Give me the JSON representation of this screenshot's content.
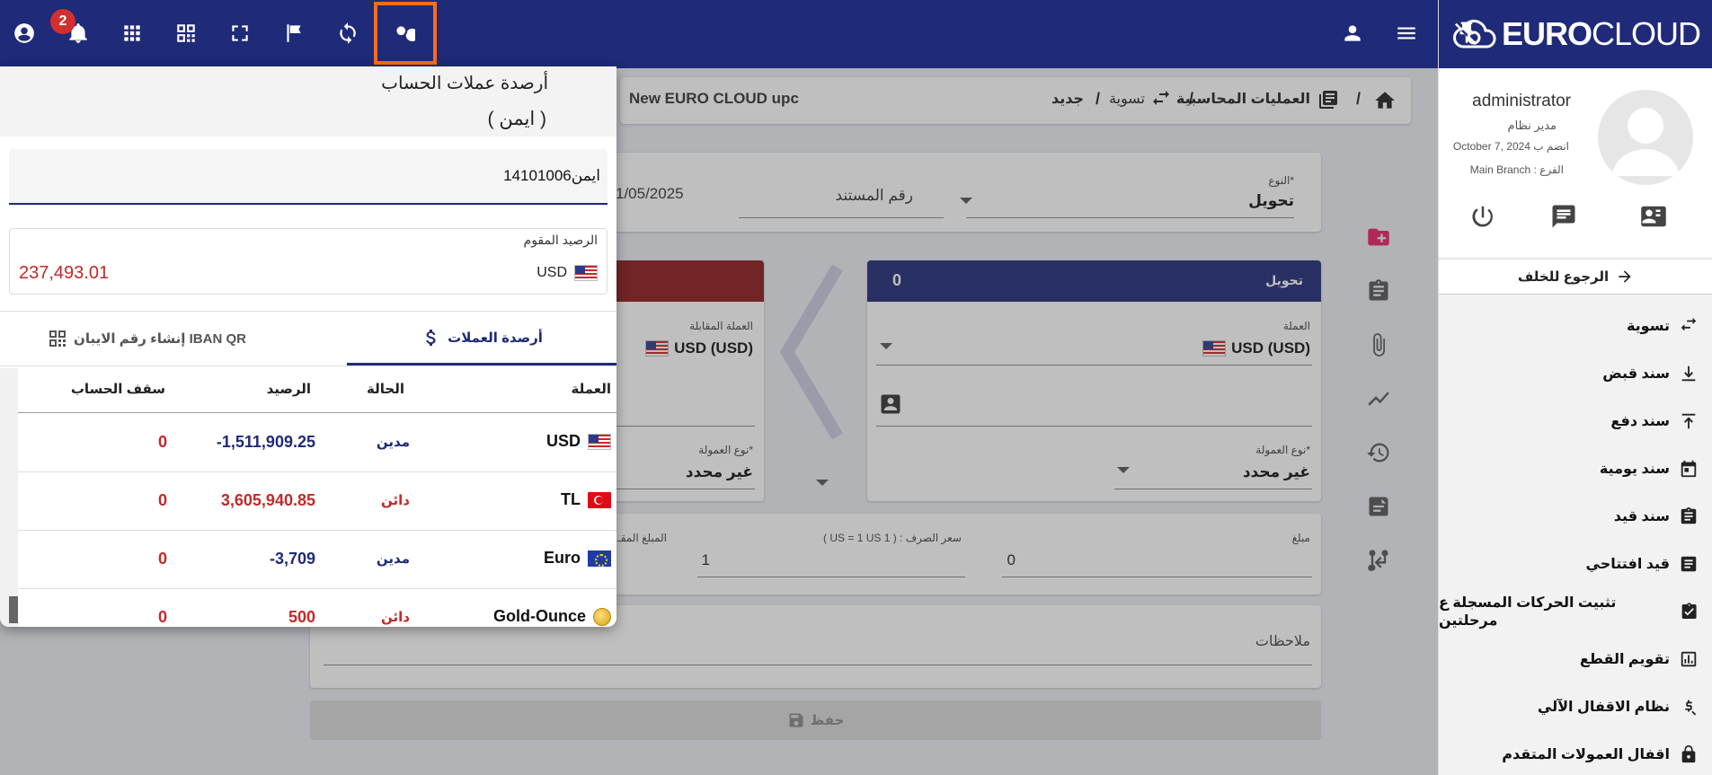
{
  "topbar": {
    "notification_count": "2",
    "icons": [
      "account-circle-icon",
      "bell-icon",
      "apps-grid-icon",
      "qr-scan-icon",
      "fullscreen-icon",
      "flag-icon",
      "sync-icon",
      "search-icon",
      "person-icon",
      "menu-icon"
    ]
  },
  "brand": {
    "name_bold": "EURO",
    "name_light": "CLOUD"
  },
  "profile": {
    "name": "administrator",
    "role": "مدير نظام",
    "joined": "October 7, 2024 انضم ب",
    "branch": "Main Branch : الفرع"
  },
  "sidebar": {
    "back_label": "الرجوع للخلف",
    "items": [
      {
        "label": "تسوية",
        "icon": "swap-icon"
      },
      {
        "label": "سند قبض",
        "icon": "download-icon"
      },
      {
        "label": "سند دفع",
        "icon": "upload-icon"
      },
      {
        "label": "سند يومية",
        "icon": "calendar-icon"
      },
      {
        "label": "سند قيد",
        "icon": "clipboard-icon"
      },
      {
        "label": "قيد افتتاحي",
        "icon": "list-icon"
      },
      {
        "label": "تثبيت الحركات المسجلة ع مرحلتين",
        "icon": "clipboard-check-icon"
      },
      {
        "label": "تقويم القطع",
        "icon": "chart-icon"
      },
      {
        "label": "نظام الاقفال الآلي",
        "icon": "auto-lock-icon"
      },
      {
        "label": "اقفال العمولات المتقدم",
        "icon": "lock-icon"
      }
    ]
  },
  "breadcrumb": {
    "level1": "العمليات المحاسبية",
    "level2": "تسوية",
    "level3": "جديد",
    "ticker": "New EURO CLOUD upc"
  },
  "form": {
    "type_label": "النوع*",
    "type_value": "تحويل",
    "doc_number_label": "رقم المستند",
    "date_value": "1/05/2025",
    "transfer_label": "تحويل",
    "transfer_count": "0",
    "currency_label": "العملة",
    "currency_value": "USD (USD)",
    "counter_currency_label": "العملة المقابلة",
    "counter_currency_value": "USD (USD)",
    "commission_type_label": "نوع العمولة*",
    "commission_type_value": "غير محدد",
    "commission_type_label_2": "نوع العمولة*",
    "commission_type_value_2": "غير محدد",
    "amount_label": "مبلغ",
    "amount_value": "0",
    "rate_label": "( US = 1 US 1 ) : سعر الصرف",
    "rate_value": "1",
    "counter_amount_label": "المبلغ المقـ",
    "notes_label": "ملاحظات",
    "save_label": "حفظ"
  },
  "popup": {
    "title": "أرصدة عملات الحساب",
    "subtitle": "( ايمن )",
    "account_input_value": "ايمن14101006",
    "balance_label": "الرصيد المقوم",
    "balance_currency": "USD",
    "balance_amount": "237,493.01",
    "tab_balances": "أرصدة العملات",
    "tab_iban": "إنشاء رقم الايبان IBAN QR",
    "columns": {
      "currency": "العملة",
      "state": "الحالة",
      "balance": "الرصيد",
      "cap": "سقف الحساب"
    },
    "rows": [
      {
        "currency": "USD",
        "flag": "us",
        "state": "مدين",
        "state_type": "debit",
        "balance": "-1,511,909.25",
        "cap": "0"
      },
      {
        "currency": "TL",
        "flag": "tr",
        "state": "دائن",
        "state_type": "credit",
        "balance": "3,605,940.85",
        "cap": "0"
      },
      {
        "currency": "Euro",
        "flag": "eu",
        "state": "مدين",
        "state_type": "debit",
        "balance": "-3,709",
        "cap": "0"
      },
      {
        "currency": "Gold-Ounce",
        "flag": "gold",
        "state": "دائن",
        "state_type": "credit",
        "balance": "500",
        "cap": "0"
      }
    ]
  },
  "colors": {
    "primary": "#1f2a78",
    "danger": "#c62828",
    "highlight": "#ff6b1a",
    "accent_pink": "#e91e63"
  }
}
